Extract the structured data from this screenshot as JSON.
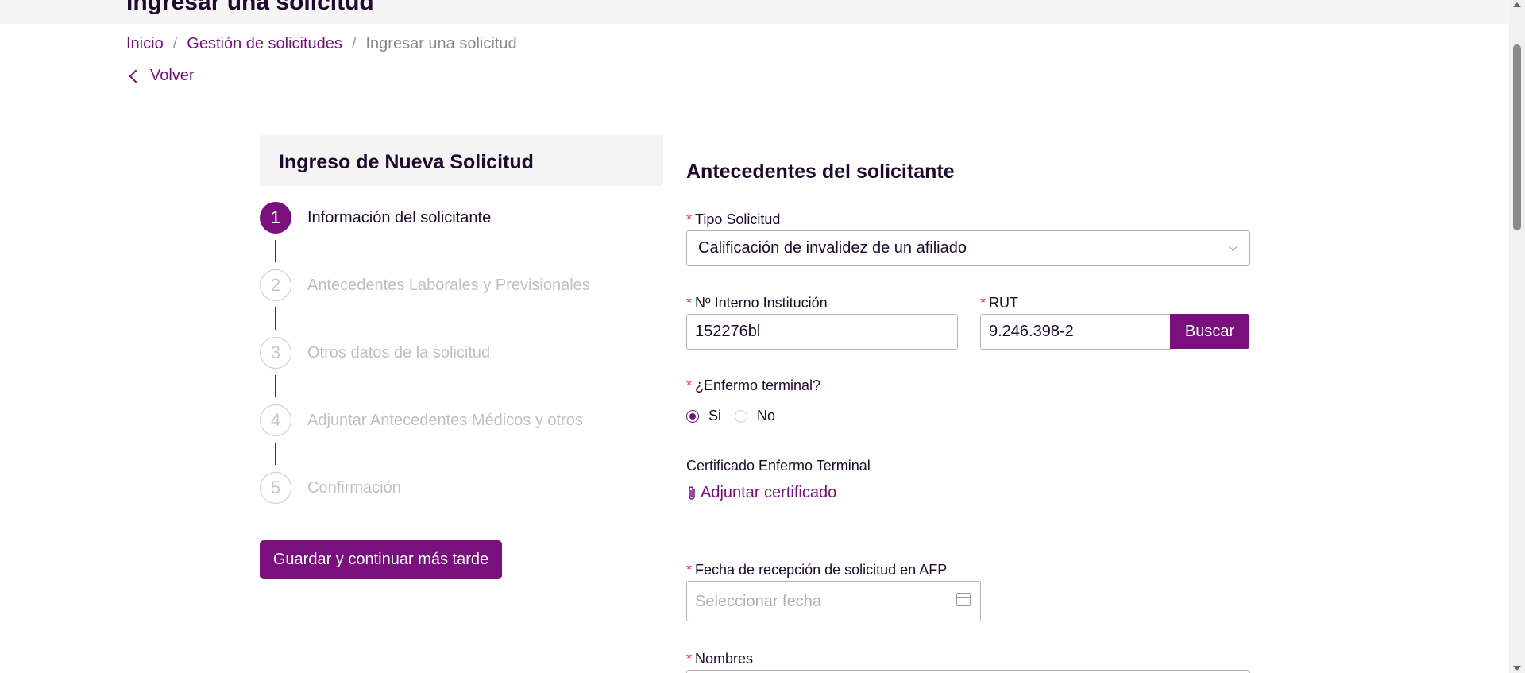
{
  "page": {
    "title": "Ingresar una solicitud"
  },
  "breadcrumb": {
    "items": [
      "Inicio",
      "Gestión de solicitudes",
      "Ingresar una solicitud"
    ],
    "separator": "/"
  },
  "back_label": "Volver",
  "stepper": {
    "title": "Ingreso de Nueva Solicitud",
    "steps": [
      {
        "number": "1",
        "label": "Información del solicitante",
        "state": "active"
      },
      {
        "number": "2",
        "label": "Antecedentes Laborales y Previsionales",
        "state": "inactive"
      },
      {
        "number": "3",
        "label": "Otros datos de la solicitud",
        "state": "inactive"
      },
      {
        "number": "4",
        "label": "Adjuntar Antecedentes Médicos y otros",
        "state": "inactive"
      },
      {
        "number": "5",
        "label": "Confirmación",
        "state": "inactive"
      }
    ],
    "save_label": "Guardar y continuar más tarde"
  },
  "form": {
    "title": "Antecedentes del solicitante",
    "required_mark": "*",
    "tipo_solicitud": {
      "label": "Tipo Solicitud",
      "value": "Calificación de invalidez de un afiliado"
    },
    "nro_interno": {
      "label": "Nº Interno Institución",
      "value": "152276bl"
    },
    "rut": {
      "label": "RUT",
      "value": "9.246.398-2",
      "button_label": "Buscar"
    },
    "enfermo_terminal": {
      "label": "¿Enfermo terminal?",
      "options": [
        "Si",
        "No"
      ],
      "selected": "Si"
    },
    "certificado": {
      "label": "Certificado Enfermo Terminal",
      "link_label": "Adjuntar certificado"
    },
    "fecha_recepcion": {
      "label": "Fecha de recepción de solicitud en AFP",
      "placeholder": "Seleccionar fecha"
    },
    "nombres": {
      "label": "Nombres"
    }
  },
  "colors": {
    "accent": "#7a0f7e",
    "required": "#e23a5e",
    "text": "#1f0a2e",
    "inactive": "#c0c0c0"
  },
  "icons": {
    "back": "chevron-left-icon",
    "dropdown": "chevron-down-icon",
    "attach": "paperclip-icon",
    "calendar": "calendar-icon"
  }
}
